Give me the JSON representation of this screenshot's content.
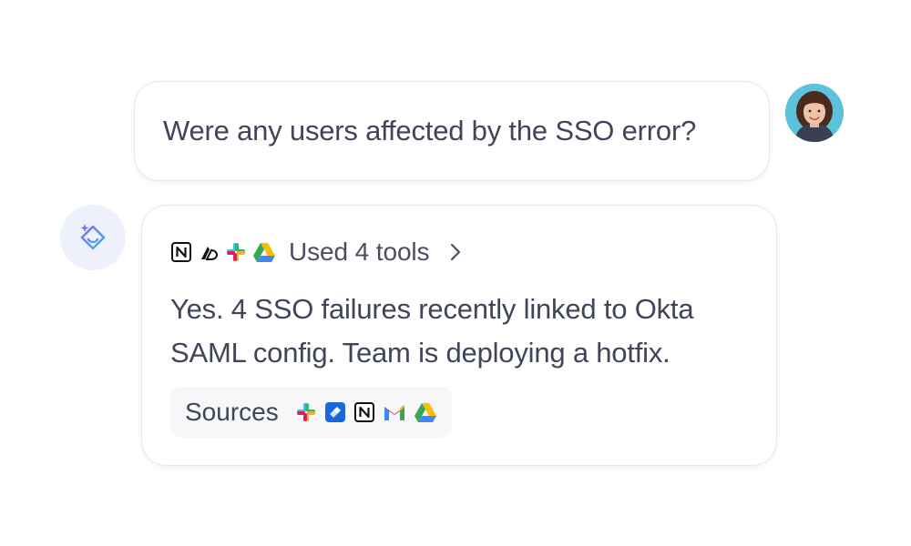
{
  "user_message": {
    "text": "Were any users affected by the SSO error?"
  },
  "assistant_message": {
    "tools_label": "Used 4 tools",
    "tool_icons": [
      "notion-icon",
      "linear-icon",
      "slack-icon",
      "google-drive-icon"
    ],
    "answer_line_1": "Yes. 4 SSO failures recently linked to Okta",
    "answer_line_2": "SAML config. Team is deploying a hotfix.",
    "sources_label": "Sources",
    "source_icons": [
      "slack-icon",
      "jira-icon",
      "notion-icon",
      "gmail-icon",
      "google-drive-icon"
    ]
  },
  "colors": {
    "text": "#41455a",
    "border": "#e6e7ec",
    "assistant_avatar_bg": "#eef1fb",
    "sources_bg": "#f6f7f9"
  }
}
